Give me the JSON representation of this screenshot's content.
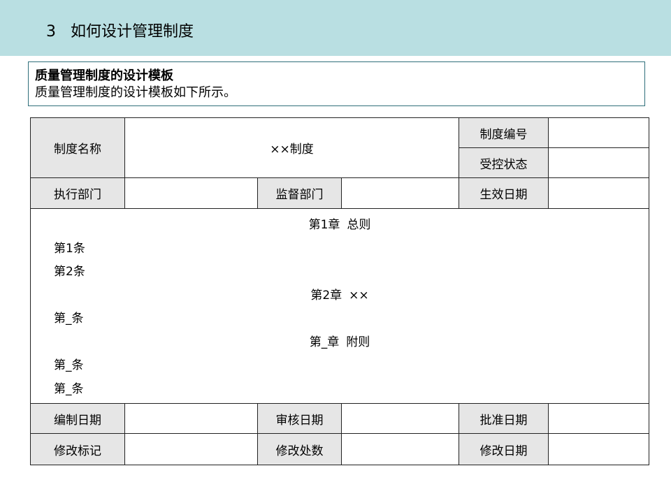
{
  "header": {
    "number": "3",
    "title": "如何设计管理制度"
  },
  "info": {
    "heading": "质量管理制度的设计模板",
    "description": "质量管理制度的设计模板如下所示。"
  },
  "table": {
    "name_label": "制度名称",
    "name_value": "××制度",
    "code_label": "制度编号",
    "status_label": "受控状态",
    "exec_dept_label": "执行部门",
    "supervise_dept_label": "监督部门",
    "effective_date_label": "生效日期",
    "content": {
      "ch1": {
        "title": "第1章",
        "name": "总则"
      },
      "art1": "第1条",
      "art2": "第2条",
      "ch2": {
        "title": "第2章",
        "name": "××"
      },
      "art3": "第_条",
      "ch3": {
        "title": "第_章",
        "name": "附则"
      },
      "art4": "第_条",
      "art5": "第_条"
    },
    "edit_date_label": "编制日期",
    "review_date_label": "审核日期",
    "approve_date_label": "批准日期",
    "revision_mark_label": "修改标记",
    "revision_count_label": "修改处数",
    "revision_date_label": "修改日期"
  }
}
